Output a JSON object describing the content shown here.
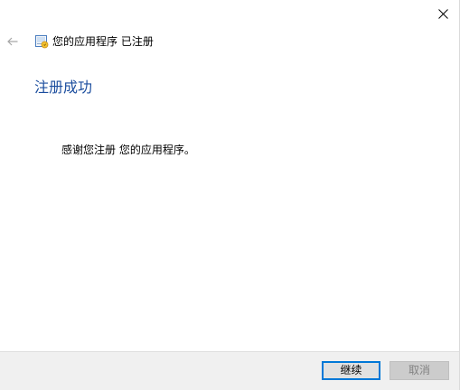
{
  "window": {
    "title": "您的应用程序 已注册"
  },
  "main": {
    "heading": "注册成功",
    "message": "感谢您注册 您的应用程序。"
  },
  "nav": {
    "back_enabled": false
  },
  "footer": {
    "continue_button": {
      "label": "继续",
      "enabled": true
    },
    "cancel_button": {
      "label": "取消",
      "enabled": false
    }
  },
  "icons": {
    "close": "close-icon",
    "back": "back-arrow-icon",
    "app": "certificate-icon"
  },
  "colors": {
    "background": "#ffffff",
    "heading": "#1b4d9e",
    "footer_background": "#f0f0f0",
    "accent": "#0078d7",
    "disabled_text": "#838383"
  }
}
